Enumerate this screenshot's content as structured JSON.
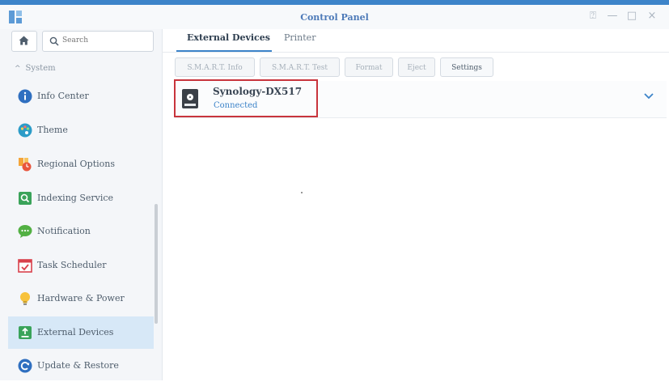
{
  "window": {
    "title": "Control Panel",
    "controls": {
      "pin": "⍰",
      "minimize": "—",
      "maximize": "□",
      "close": "×"
    }
  },
  "sidebar": {
    "search_placeholder": "Search",
    "section_label": "System",
    "items": [
      {
        "label": "Info Center",
        "icon": "info-icon"
      },
      {
        "label": "Theme",
        "icon": "palette-icon"
      },
      {
        "label": "Regional Options",
        "icon": "regional-clock-icon"
      },
      {
        "label": "Indexing Service",
        "icon": "indexing-search-icon"
      },
      {
        "label": "Notification",
        "icon": "chat-bubble-icon"
      },
      {
        "label": "Task Scheduler",
        "icon": "calendar-check-icon"
      },
      {
        "label": "Hardware & Power",
        "icon": "lightbulb-icon"
      },
      {
        "label": "External Devices",
        "icon": "external-device-icon",
        "active": true
      },
      {
        "label": "Update & Restore",
        "icon": "refresh-icon"
      }
    ]
  },
  "tabs": [
    {
      "label": "External Devices",
      "active": true
    },
    {
      "label": "Printer",
      "active": false
    }
  ],
  "toolbar": {
    "smart_info": "S.M.A.R.T. Info",
    "smart_test": "S.M.A.R.T. Test",
    "format": "Format",
    "eject": "Eject",
    "settings": "Settings"
  },
  "device": {
    "name": "Synology-DX517",
    "status": "Connected"
  },
  "colors": {
    "accent": "#3d84c9",
    "highlight_border": "#c8343c",
    "active_nav_bg": "#d7e8f7"
  }
}
